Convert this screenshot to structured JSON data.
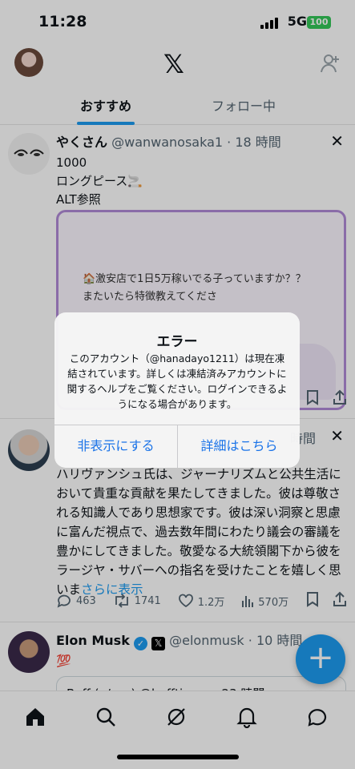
{
  "status_bar": {
    "time": "11:28",
    "network": "5G",
    "battery": "100"
  },
  "tabs": {
    "active": "おすすめ",
    "other": "フォロー中"
  },
  "posts": [
    {
      "name": "やくさん",
      "handle": "@wanwanosaka1",
      "time": "18 時間",
      "lines": [
        "1000",
        "ロングピース🚬",
        "ALT参照"
      ],
      "media_line1": "🏠激安店で1日5万稼いでる子っていますか？？",
      "media_line2": "またいたら特徴教えてくださ"
    },
    {
      "time": "時間",
      "text": "ハリヴァンシュ氏は、ジャーナリズムと公共生活において貴重な貢献を果たしてきました。彼は尊敬される知識人であり思想家です。彼は深い洞察と思慮に富んだ視点で、過去数年間にわたり議会の審議を豊かにしてきました。敬愛なる大統領閣下から彼をラージヤ・サバーへの指名を受けたことを嬉しく思いま",
      "more": "さらに表示",
      "replies": "463",
      "reposts": "1741",
      "likes": "1.2万",
      "views": "570万"
    },
    {
      "name": "Elon Musk",
      "handle": "@elonmusk",
      "time": "10 時間",
      "text": "💯",
      "quote": "Beff (e/acc) @bafftjezos · 23 時間"
    }
  ],
  "dialog": {
    "title": "エラー",
    "message": "このアカウント（@hanadayo1211）は現在凍結されています。詳しくは凍結済みアカウントに関するヘルプをご覧ください。ログインできるようになる場合があります。",
    "button_hide": "非表示にする",
    "button_details": "詳細はこちら"
  },
  "colors": {
    "accent": "#1d9bf0",
    "dialog_button": "#1a73e8"
  }
}
